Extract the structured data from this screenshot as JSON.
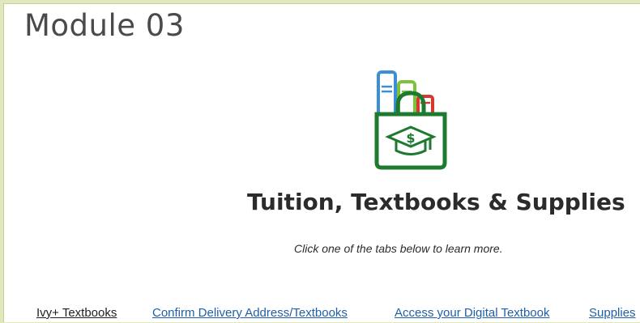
{
  "header": {
    "module_title": "Module 03"
  },
  "hero": {
    "icon": "shopping-bag-books-graduation-cap-icon",
    "title": "Tuition, Textbooks & Supplies",
    "subtitle": "Click one of the tabs below to learn more."
  },
  "tabs": [
    {
      "label": "Ivy+ Textbooks",
      "active": true
    },
    {
      "label": "Confirm Delivery Address/Textbooks",
      "active": false
    },
    {
      "label": "Access your Digital Textbook",
      "active": false
    },
    {
      "label": "Supplies",
      "active": false
    }
  ],
  "colors": {
    "page_border": "#c9cf8d",
    "link": "#1f5fa8",
    "active_tab": "#1f1f1f",
    "icon_green": "#1e7a2e",
    "icon_blue": "#3a8fd6",
    "icon_light_green": "#7cc23f",
    "icon_red": "#d23a2e"
  }
}
